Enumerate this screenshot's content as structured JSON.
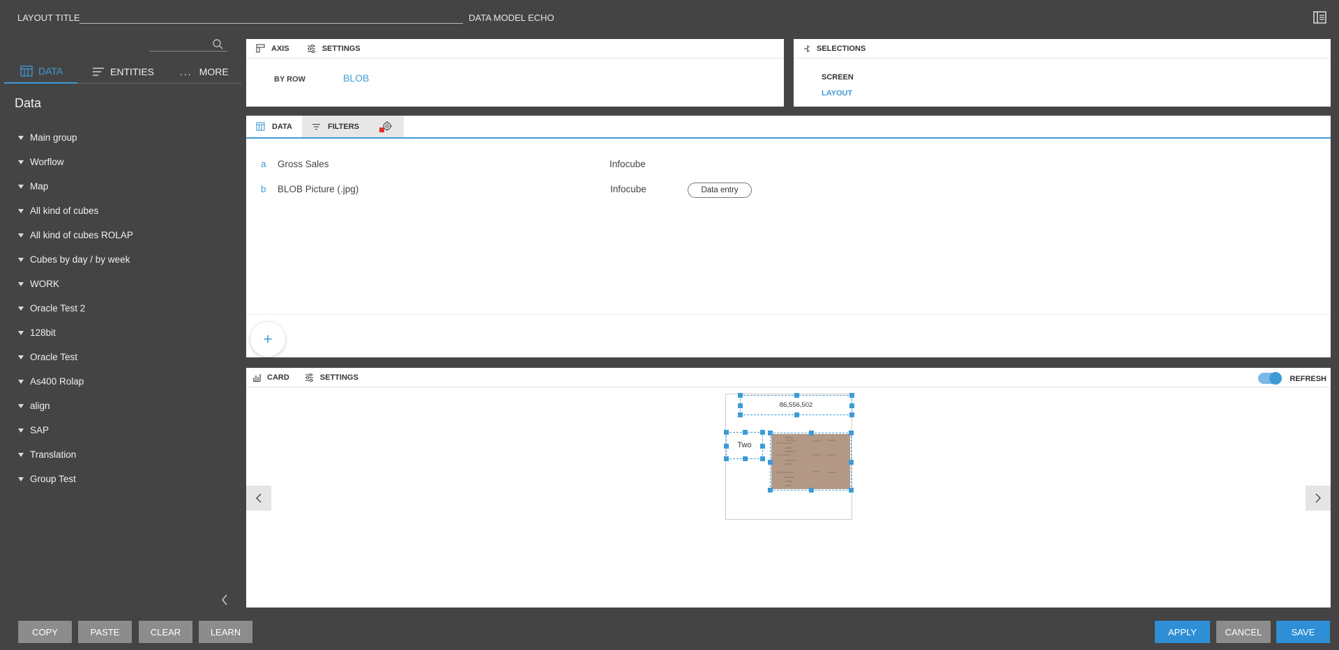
{
  "header": {
    "layout_title_label": "LAYOUT TITLE",
    "layout_title_value": "",
    "data_model_label": "DATA MODEL",
    "data_model_value": "ECHO"
  },
  "sidebar": {
    "search_placeholder": "",
    "tabs": [
      {
        "label": "DATA",
        "icon": "data-grid-icon",
        "active": true
      },
      {
        "label": "ENTITIES",
        "icon": "list-lines-icon",
        "active": false
      },
      {
        "label": "MORE",
        "icon": "ellipsis-icon",
        "active": false
      }
    ],
    "heading": "Data",
    "tree": [
      "Main group",
      "Worflow",
      "Map",
      "All kind of cubes",
      "All kind of cubes ROLAP",
      "Cubes by day / by week",
      "WORK",
      "Oracle Test 2",
      "128bit",
      "Oracle Test",
      "As400 Rolap",
      "align",
      "SAP",
      "Translation",
      "Group Test"
    ]
  },
  "axis_panel": {
    "tabs": [
      "AXIS",
      "SETTINGS"
    ],
    "by_row_label": "BY ROW",
    "by_row_value": "BLOB"
  },
  "selections_panel": {
    "title": "SELECTIONS",
    "items": [
      {
        "label": "SCREEN",
        "active": false
      },
      {
        "label": "LAYOUT",
        "active": true
      }
    ]
  },
  "data_panel": {
    "tabs": [
      "DATA",
      "FILTERS"
    ],
    "rows": [
      {
        "letter": "a",
        "name": "Gross Sales",
        "source": "Infocube",
        "action": ""
      },
      {
        "letter": "b",
        "name": "BLOB Picture (.jpg)",
        "source": "Infocube",
        "action": "Data entry"
      }
    ],
    "add_symbol": "+"
  },
  "card_panel": {
    "tabs": [
      "CARD",
      "SETTINGS"
    ],
    "refresh_label": "REFRESH",
    "refresh_on": true,
    "value_text": "86,556,502",
    "label_text": "Two"
  },
  "footer": {
    "left_buttons": [
      "COPY",
      "PASTE",
      "CLEAR",
      "LEARN"
    ],
    "apply_label": "APPLY",
    "cancel_label": "CANCEL",
    "save_label": "SAVE"
  },
  "colors": {
    "accent": "#3e9bd8",
    "background": "#444444",
    "button_gray": "#8c8c8c",
    "button_blue": "#2e8fd6",
    "alert_red": "#e0322b"
  }
}
